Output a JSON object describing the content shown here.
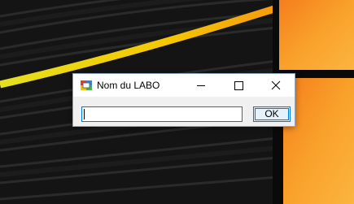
{
  "dialog": {
    "title": "Nom du LABO",
    "icon": "application-icon",
    "input": {
      "value": "",
      "placeholder": ""
    },
    "ok_label": "OK"
  },
  "caption_buttons": {
    "minimize_icon": "minimize-icon",
    "maximize_icon": "maximize-icon",
    "close_icon": "close-icon"
  },
  "colors": {
    "accent": "#0078d7",
    "wallpaper_dark": "#121212",
    "wallpaper_orange": "#f9a12a",
    "wallpaper_stripe": "#f5c800"
  }
}
